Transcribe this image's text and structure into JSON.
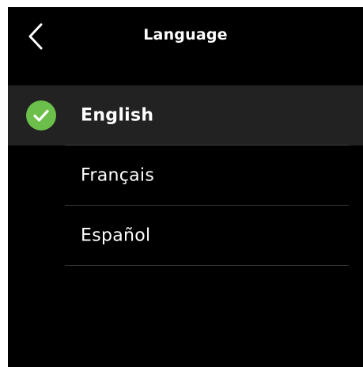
{
  "header": {
    "title": "Language",
    "back_icon": "chevron-left-icon"
  },
  "languages": [
    {
      "label": "English",
      "selected": true
    },
    {
      "label": "Français",
      "selected": false
    },
    {
      "label": "Español",
      "selected": false
    }
  ],
  "colors": {
    "background": "#000000",
    "selected_row": "#222222",
    "check_green": "#6cbf4a",
    "text": "#ffffff",
    "divider": "#3a3a3a"
  },
  "selected_icon": "check-circle-icon"
}
